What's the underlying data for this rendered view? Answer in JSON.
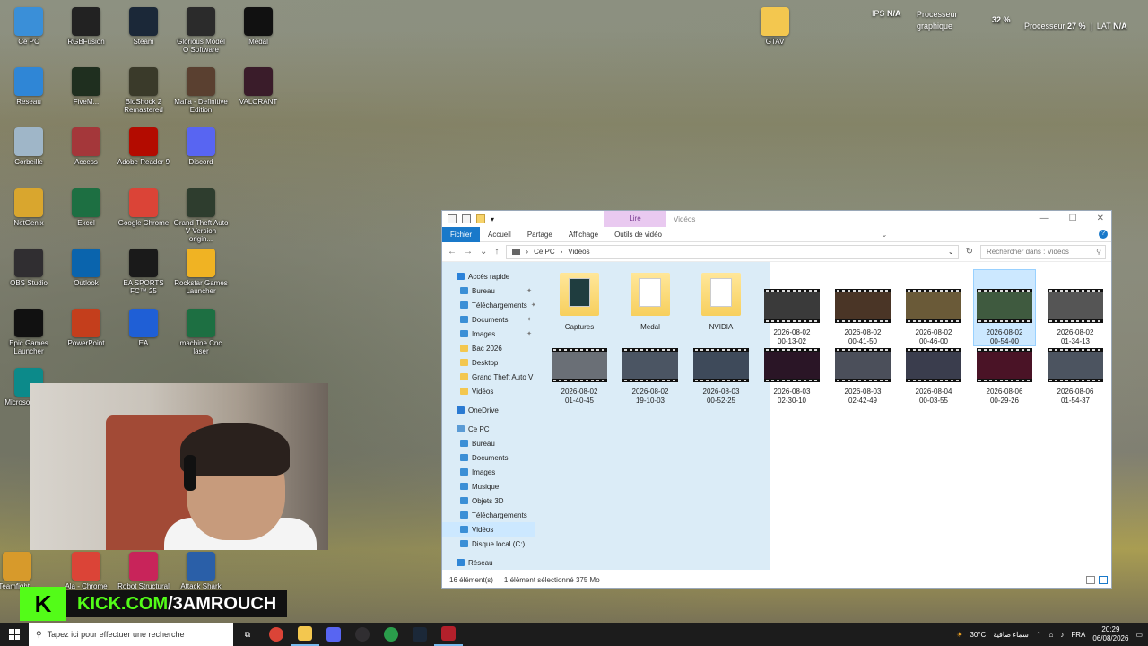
{
  "desktop_icons": [
    {
      "label": "Ce PC",
      "icon": "computer-icon",
      "color": "#3a8fd8"
    },
    {
      "label": "RGBFusion",
      "icon": "rgb-fusion-icon",
      "color": "#222222"
    },
    {
      "label": "Steam",
      "icon": "steam-icon",
      "color": "#1b2838"
    },
    {
      "label": "Glorious Model O Software",
      "icon": "mouse-icon",
      "color": "#2b2b2b"
    },
    {
      "label": "Medal",
      "icon": "medal-icon",
      "color": "#111111"
    },
    {
      "label": "Reseau",
      "icon": "network-icon",
      "color": "#2f86d6"
    },
    {
      "label": "FiveM...",
      "icon": "fivem-icon",
      "color": "#1f2f1f"
    },
    {
      "label": "BioShock 2 Remastered",
      "icon": "bioshock-icon",
      "color": "#3a3a2a"
    },
    {
      "label": "Mafia - Definitive Edition",
      "icon": "mafia-icon",
      "color": "#5a4030"
    },
    {
      "label": "VALORANT",
      "icon": "valorant-icon",
      "color": "#3a1c2a"
    },
    {
      "label": "Corbeille",
      "icon": "recycle-bin-icon",
      "color": "#9fb6c8"
    },
    {
      "label": "Access",
      "icon": "access-icon",
      "color": "#a4373a"
    },
    {
      "label": "Adobe Reader 9",
      "icon": "adobe-reader-icon",
      "color": "#b30b00"
    },
    {
      "label": "Discord",
      "icon": "discord-icon",
      "color": "#5865f2"
    },
    {
      "label": "NetGenix",
      "icon": "netgenix-icon",
      "color": "#d9a62e"
    },
    {
      "label": "Excel",
      "icon": "excel-icon",
      "color": "#1d6f42"
    },
    {
      "label": "Google Chrome",
      "icon": "chrome-icon",
      "color": "#db4437"
    },
    {
      "label": "Grand Theft Auto V Version origin...",
      "icon": "gta-icon",
      "color": "#2e3d2e"
    },
    {
      "label": "OBS Studio",
      "icon": "obs-icon",
      "color": "#302e31"
    },
    {
      "label": "Outlook",
      "icon": "outlook-icon",
      "color": "#0a64ad"
    },
    {
      "label": "EA SPORTS FC™ 25",
      "icon": "easportsfc-icon",
      "color": "#1a1a1a"
    },
    {
      "label": "Rockstar Games Launcher",
      "icon": "rockstar-icon",
      "color": "#f0b323"
    },
    {
      "label": "Epic Games Launcher",
      "icon": "epic-games-icon",
      "color": "#111111"
    },
    {
      "label": "PowerPoint",
      "icon": "powerpoint-icon",
      "color": "#c43e1c"
    },
    {
      "label": "EA",
      "icon": "ea-icon",
      "color": "#1f5fd6"
    },
    {
      "label": "machine Cnc laser",
      "icon": "excel-file-icon",
      "color": "#1d6f42"
    },
    {
      "label": "Microsoft Edge",
      "icon": "edge-icon",
      "color": "#0c8a8a"
    },
    {
      "label": "Teamfight...",
      "icon": "teamfight-icon",
      "color": "#d79a2b"
    },
    {
      "label": "Ala - Chrome",
      "icon": "chrome-profile-icon",
      "color": "#db4437"
    },
    {
      "label": "Robot Structural",
      "icon": "robot-structural-icon",
      "color": "#c8245a"
    },
    {
      "label": "Attack Shark",
      "icon": "attack-shark-icon",
      "color": "#2a5fa8"
    },
    {
      "label": "GTAV",
      "icon": "folder-icon",
      "color": "#f3c74f"
    }
  ],
  "perf_overlay": {
    "ips_label": "IPS",
    "ips_value": "N/A",
    "gpu_label_1": "Processeur",
    "gpu_label_2": "graphique",
    "gpu_value": "32 %",
    "cpu_label": "Processeur",
    "cpu_value": "27 %",
    "lat_label": "LAT",
    "lat_value": "N/A"
  },
  "explorer": {
    "context_tab": "Lire",
    "window_title": "Vidéos",
    "ribbon_tabs": [
      "Fichier",
      "Accueil",
      "Partage",
      "Affichage",
      "Outils de vidéo"
    ],
    "breadcrumb": [
      "Ce PC",
      "Vidéos"
    ],
    "search_placeholder": "Rechercher dans : Vidéos",
    "nav": {
      "quick_access": "Accès rapide",
      "quick_items": [
        {
          "label": "Bureau",
          "pinned": true
        },
        {
          "label": "Téléchargements",
          "pinned": true
        },
        {
          "label": "Documents",
          "pinned": true
        },
        {
          "label": "Images",
          "pinned": true
        },
        {
          "label": "Bac 2026",
          "pinned": false
        },
        {
          "label": "Desktop",
          "pinned": false
        },
        {
          "label": "Grand Theft Auto V",
          "pinned": false
        },
        {
          "label": "Vidéos",
          "pinned": false
        }
      ],
      "onedrive": "OneDrive",
      "this_pc": "Ce PC",
      "pc_items": [
        "Bureau",
        "Documents",
        "Images",
        "Musique",
        "Objets 3D",
        "Téléchargements",
        "Vidéos",
        "Disque local (C:)"
      ],
      "network": "Réseau"
    },
    "folders": [
      "Captures",
      "Medal",
      "NVIDIA"
    ],
    "videos": [
      {
        "date": "2026-08-02",
        "time": "00-13-02"
      },
      {
        "date": "2026-08-02",
        "time": "00-41-50"
      },
      {
        "date": "2026-08-02",
        "time": "00-46-00"
      },
      {
        "date": "2026-08-02",
        "time": "00-54-00"
      },
      {
        "date": "2026-08-02",
        "time": "01-34-13"
      },
      {
        "date": "2026-08-02",
        "time": "01-40-45"
      },
      {
        "date": "2026-08-02",
        "time": "19-10-03"
      },
      {
        "date": "2026-08-03",
        "time": "00-52-25"
      },
      {
        "date": "2026-08-03",
        "time": "02-30-10"
      },
      {
        "date": "2026-08-03",
        "time": "02-42-49"
      },
      {
        "date": "2026-08-04",
        "time": "00-03-55"
      },
      {
        "date": "2026-08-06",
        "time": "00-29-26"
      },
      {
        "date": "2026-08-06",
        "time": "01-54-37"
      }
    ],
    "status_count": "16 élément(s)",
    "status_selection": "1 élément sélectionné  375 Mo"
  },
  "banner": {
    "k": "K",
    "part1": "KICK.COM",
    "part2": "/3AMROUCH"
  },
  "taskbar": {
    "search_placeholder": "Tapez ici pour effectuer une recherche",
    "weather": "30°C",
    "weather_text": "سماء صافية",
    "lang": "FRA",
    "time": "20:29",
    "date": "06/08/2026"
  }
}
